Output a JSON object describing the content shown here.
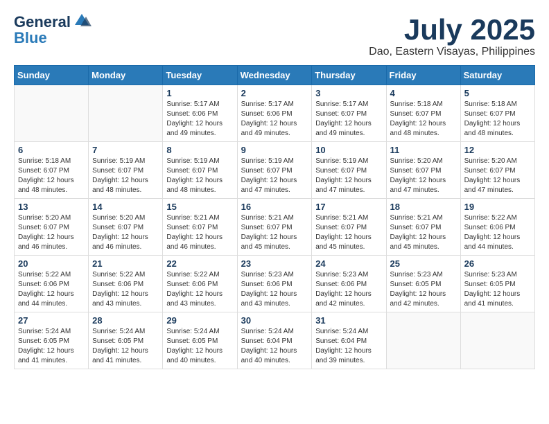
{
  "logo": {
    "general": "General",
    "blue": "Blue"
  },
  "title": {
    "month_year": "July 2025",
    "location": "Dao, Eastern Visayas, Philippines"
  },
  "weekdays": [
    "Sunday",
    "Monday",
    "Tuesday",
    "Wednesday",
    "Thursday",
    "Friday",
    "Saturday"
  ],
  "weeks": [
    [
      {
        "day": "",
        "info": ""
      },
      {
        "day": "",
        "info": ""
      },
      {
        "day": "1",
        "info": "Sunrise: 5:17 AM\nSunset: 6:06 PM\nDaylight: 12 hours and 49 minutes."
      },
      {
        "day": "2",
        "info": "Sunrise: 5:17 AM\nSunset: 6:06 PM\nDaylight: 12 hours and 49 minutes."
      },
      {
        "day": "3",
        "info": "Sunrise: 5:17 AM\nSunset: 6:07 PM\nDaylight: 12 hours and 49 minutes."
      },
      {
        "day": "4",
        "info": "Sunrise: 5:18 AM\nSunset: 6:07 PM\nDaylight: 12 hours and 48 minutes."
      },
      {
        "day": "5",
        "info": "Sunrise: 5:18 AM\nSunset: 6:07 PM\nDaylight: 12 hours and 48 minutes."
      }
    ],
    [
      {
        "day": "6",
        "info": "Sunrise: 5:18 AM\nSunset: 6:07 PM\nDaylight: 12 hours and 48 minutes."
      },
      {
        "day": "7",
        "info": "Sunrise: 5:19 AM\nSunset: 6:07 PM\nDaylight: 12 hours and 48 minutes."
      },
      {
        "day": "8",
        "info": "Sunrise: 5:19 AM\nSunset: 6:07 PM\nDaylight: 12 hours and 48 minutes."
      },
      {
        "day": "9",
        "info": "Sunrise: 5:19 AM\nSunset: 6:07 PM\nDaylight: 12 hours and 47 minutes."
      },
      {
        "day": "10",
        "info": "Sunrise: 5:19 AM\nSunset: 6:07 PM\nDaylight: 12 hours and 47 minutes."
      },
      {
        "day": "11",
        "info": "Sunrise: 5:20 AM\nSunset: 6:07 PM\nDaylight: 12 hours and 47 minutes."
      },
      {
        "day": "12",
        "info": "Sunrise: 5:20 AM\nSunset: 6:07 PM\nDaylight: 12 hours and 47 minutes."
      }
    ],
    [
      {
        "day": "13",
        "info": "Sunrise: 5:20 AM\nSunset: 6:07 PM\nDaylight: 12 hours and 46 minutes."
      },
      {
        "day": "14",
        "info": "Sunrise: 5:20 AM\nSunset: 6:07 PM\nDaylight: 12 hours and 46 minutes."
      },
      {
        "day": "15",
        "info": "Sunrise: 5:21 AM\nSunset: 6:07 PM\nDaylight: 12 hours and 46 minutes."
      },
      {
        "day": "16",
        "info": "Sunrise: 5:21 AM\nSunset: 6:07 PM\nDaylight: 12 hours and 45 minutes."
      },
      {
        "day": "17",
        "info": "Sunrise: 5:21 AM\nSunset: 6:07 PM\nDaylight: 12 hours and 45 minutes."
      },
      {
        "day": "18",
        "info": "Sunrise: 5:21 AM\nSunset: 6:07 PM\nDaylight: 12 hours and 45 minutes."
      },
      {
        "day": "19",
        "info": "Sunrise: 5:22 AM\nSunset: 6:06 PM\nDaylight: 12 hours and 44 minutes."
      }
    ],
    [
      {
        "day": "20",
        "info": "Sunrise: 5:22 AM\nSunset: 6:06 PM\nDaylight: 12 hours and 44 minutes."
      },
      {
        "day": "21",
        "info": "Sunrise: 5:22 AM\nSunset: 6:06 PM\nDaylight: 12 hours and 43 minutes."
      },
      {
        "day": "22",
        "info": "Sunrise: 5:22 AM\nSunset: 6:06 PM\nDaylight: 12 hours and 43 minutes."
      },
      {
        "day": "23",
        "info": "Sunrise: 5:23 AM\nSunset: 6:06 PM\nDaylight: 12 hours and 43 minutes."
      },
      {
        "day": "24",
        "info": "Sunrise: 5:23 AM\nSunset: 6:06 PM\nDaylight: 12 hours and 42 minutes."
      },
      {
        "day": "25",
        "info": "Sunrise: 5:23 AM\nSunset: 6:05 PM\nDaylight: 12 hours and 42 minutes."
      },
      {
        "day": "26",
        "info": "Sunrise: 5:23 AM\nSunset: 6:05 PM\nDaylight: 12 hours and 41 minutes."
      }
    ],
    [
      {
        "day": "27",
        "info": "Sunrise: 5:24 AM\nSunset: 6:05 PM\nDaylight: 12 hours and 41 minutes."
      },
      {
        "day": "28",
        "info": "Sunrise: 5:24 AM\nSunset: 6:05 PM\nDaylight: 12 hours and 41 minutes."
      },
      {
        "day": "29",
        "info": "Sunrise: 5:24 AM\nSunset: 6:05 PM\nDaylight: 12 hours and 40 minutes."
      },
      {
        "day": "30",
        "info": "Sunrise: 5:24 AM\nSunset: 6:04 PM\nDaylight: 12 hours and 40 minutes."
      },
      {
        "day": "31",
        "info": "Sunrise: 5:24 AM\nSunset: 6:04 PM\nDaylight: 12 hours and 39 minutes."
      },
      {
        "day": "",
        "info": ""
      },
      {
        "day": "",
        "info": ""
      }
    ]
  ]
}
